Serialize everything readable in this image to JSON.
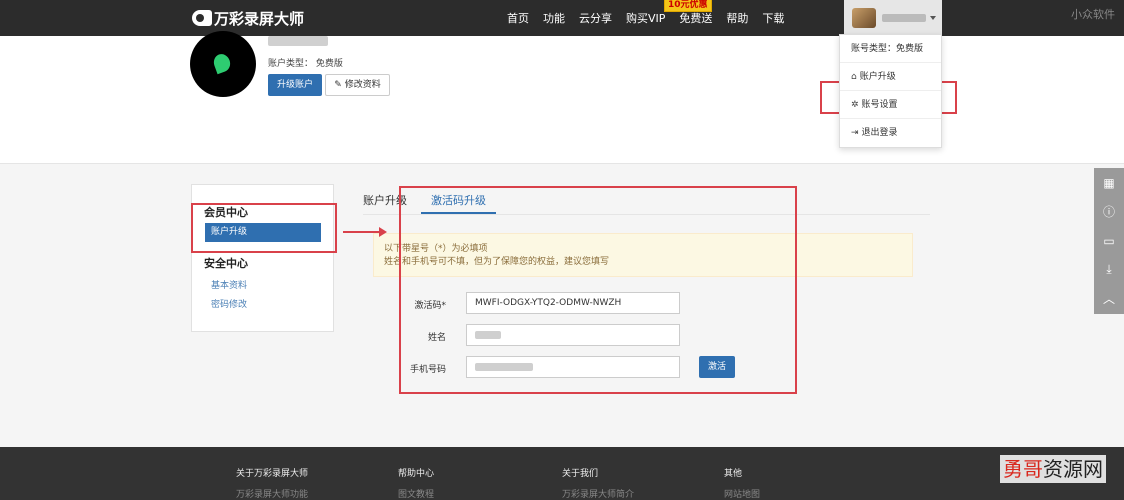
{
  "app": {
    "logo_text": "万彩录屏大师",
    "watermark_top": "小众软件",
    "watermark_bottom_a": "勇哥",
    "watermark_bottom_b": "资源网"
  },
  "nav": {
    "items": [
      {
        "label": "首页"
      },
      {
        "label": "功能"
      },
      {
        "label": "云分享"
      },
      {
        "label": "购买VIP",
        "promo": "10元优惠"
      },
      {
        "label": "免费送"
      },
      {
        "label": "帮助"
      },
      {
        "label": "下载"
      }
    ]
  },
  "dropdown": {
    "account_type": "账号类型：免费版",
    "upgrade": "账户升级",
    "settings": "账号设置",
    "logout": "退出登录"
  },
  "profile": {
    "account_type": "账户类型：  免费版",
    "upgrade_button": "升级账户",
    "edit_button": "修改资料"
  },
  "sidebar": {
    "member_center": "会员中心",
    "upgrade_item": "账户升级",
    "security_center": "安全中心",
    "basic_info": "基本资料",
    "password": "密码修改"
  },
  "tabs": {
    "account_upgrade": "账户升级",
    "activation_upgrade": "激活码升级"
  },
  "notice": {
    "line1": "以下带星号（*）为必填项",
    "line2": "姓名和手机号可不填，但为了保障您的权益，建议您填写"
  },
  "form": {
    "code_label": "激活码*",
    "code_value": "MWFI-ODGX-YTQ2-ODMW-NWZH",
    "name_label": "姓名",
    "phone_label": "手机号码",
    "activate_button": "激活"
  },
  "footer": {
    "cols": [
      {
        "heading": "关于万彩录屏大师",
        "link": "万彩录屏大师功能"
      },
      {
        "heading": "帮助中心",
        "link": "图文教程"
      },
      {
        "heading": "关于我们",
        "link": "万彩录屏大师简介"
      },
      {
        "heading": "其他",
        "link": "网站地图"
      }
    ]
  },
  "colors": {
    "primary": "#2f6fb0",
    "annotation": "#d9414a",
    "topbar": "#2c2c2c"
  },
  "icons": [
    "home-icon",
    "gear-icon",
    "logout-icon",
    "edit-icon",
    "qr-icon",
    "help-icon",
    "chat-icon",
    "download-icon",
    "back-to-top-icon"
  ]
}
